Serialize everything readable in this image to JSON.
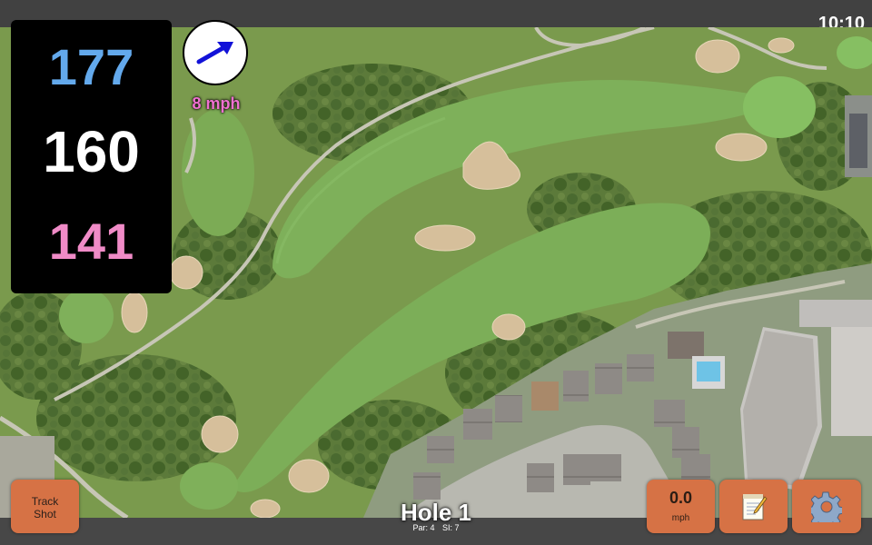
{
  "status_bar": {
    "time": "10:10"
  },
  "distances": {
    "back": "177",
    "center": "160",
    "front": "141"
  },
  "wind": {
    "speed": "8 mph",
    "direction_icon": "arrow-icon"
  },
  "hole": {
    "title": "Hole 1",
    "par": "Par: 4",
    "stroke_index": "SI: 7"
  },
  "buttons": {
    "track_shot_line1": "Track",
    "track_shot_line2": "Shot",
    "speed_value": "0.0",
    "speed_unit": "mph",
    "notes_icon": "notepad-icon",
    "settings_icon": "gear-icon"
  },
  "colors": {
    "back_distance": "#63a9ec",
    "center_distance": "#ffffff",
    "front_distance": "#f08bc7",
    "wind_text": "#ef70d0",
    "button": "#d67245",
    "wind_arrow": "#1212d8"
  }
}
